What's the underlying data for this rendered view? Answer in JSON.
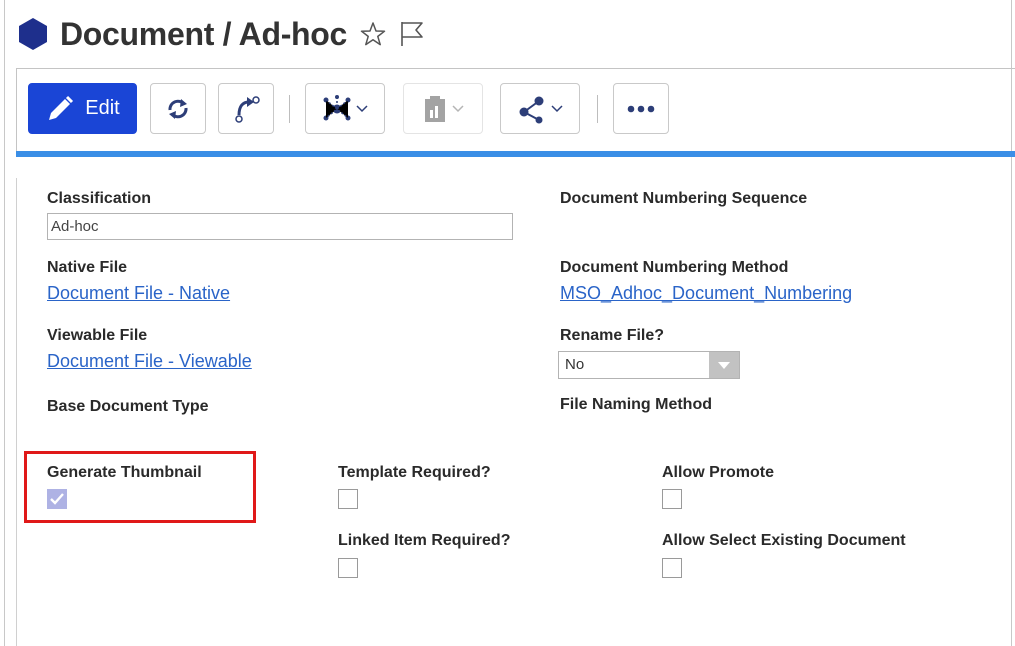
{
  "header": {
    "title": "Document / Ad-hoc",
    "icons": [
      "hexagon-icon",
      "star-icon",
      "flag-icon"
    ],
    "accent_color": "#1a45d6"
  },
  "toolbar": {
    "edit_label": "Edit",
    "icons": [
      "pencil-icon",
      "refresh-icon",
      "promote-icon",
      "network-icon",
      "report-icon",
      "share-icon",
      "more-icon"
    ]
  },
  "form": {
    "classification_label": "Classification",
    "classification_value": "Ad-hoc",
    "native_file_label": "Native File",
    "native_file_link": "Document File - Native",
    "viewable_file_label": "Viewable File",
    "viewable_file_link": "Document File - Viewable",
    "base_document_type_label": "Base Document Type",
    "numbering_sequence_label": "Document Numbering Sequence",
    "numbering_method_label": "Document Numbering Method",
    "numbering_method_link": "MSO_Adhoc_Document_Numbering",
    "rename_file_label": "Rename File?",
    "rename_file_value": "No",
    "file_naming_method_label": "File Naming Method",
    "generate_thumbnail_label": "Generate Thumbnail",
    "generate_thumbnail_checked": true,
    "template_required_label": "Template Required?",
    "template_required_checked": false,
    "linked_item_required_label": "Linked Item Required?",
    "linked_item_required_checked": false,
    "allow_promote_label": "Allow Promote",
    "allow_promote_checked": false,
    "allow_select_existing_label": "Allow Select Existing Document",
    "allow_select_existing_checked": false
  }
}
